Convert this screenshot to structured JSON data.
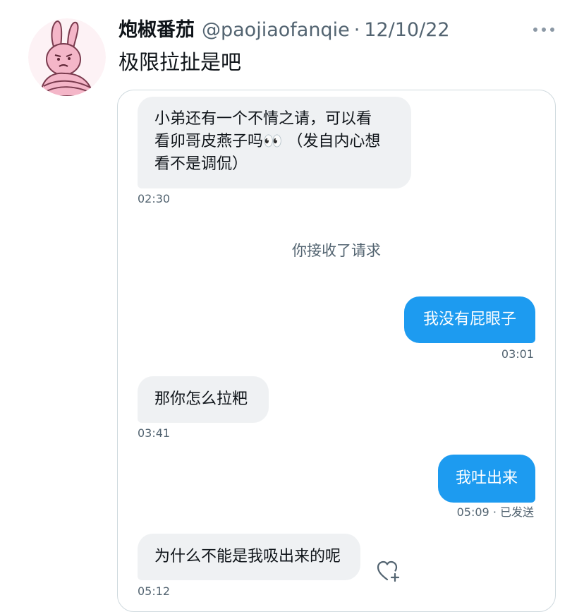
{
  "tweet": {
    "display_name": "炮椒番茄",
    "handle": "@paojiaofanqie",
    "separator": "·",
    "date": "12/10/22",
    "text": "极限拉扯是吧",
    "avatar_icon": "pink-rabbit-avatar",
    "more_icon": "more-dots-icon"
  },
  "chat": {
    "messages": [
      {
        "direction": "in",
        "lines": [
          "小弟还有一个不情之请，可以看",
          "看卯哥皮燕子吗👀 （发自内心想",
          "看不是调侃）"
        ],
        "time": "02:30"
      },
      {
        "direction": "system",
        "text": "你接收了请求"
      },
      {
        "direction": "out",
        "text": "我没有屁眼子",
        "time": "03:01"
      },
      {
        "direction": "in",
        "text": "那你怎么拉粑",
        "time": "03:41"
      },
      {
        "direction": "out",
        "text": "我吐出来",
        "time": "05:09 · 已发送"
      },
      {
        "direction": "in",
        "text": "为什么不能是我吸出来的呢",
        "time": "05:12",
        "react_icon": "heart-add-icon"
      }
    ]
  },
  "colors": {
    "outgoing_bubble": "#1d9bf0",
    "incoming_bubble": "#eff1f3",
    "secondary_text": "#536471",
    "avatar_pink": "#f4b6c8"
  }
}
